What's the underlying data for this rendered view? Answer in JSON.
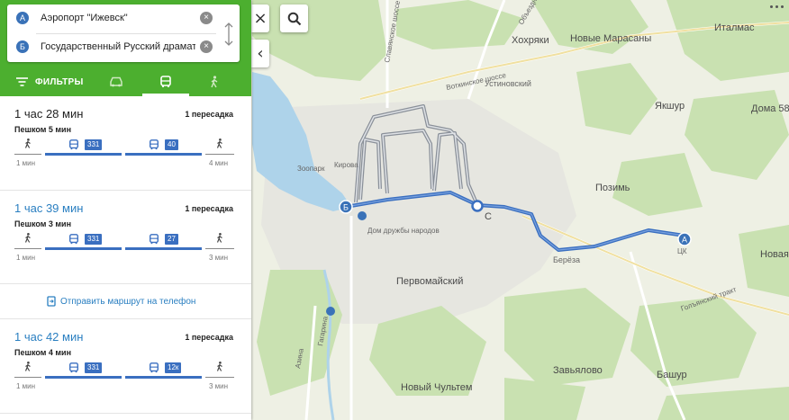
{
  "search": {
    "from_badge": "А",
    "from_value": "Аэропорт \"Ижевск\"",
    "to_badge": "Б",
    "to_value": "Государственный Русский драмат"
  },
  "filters": {
    "label": "ФИЛЬТРЫ",
    "modes": [
      {
        "name": "car",
        "icon": "car-icon",
        "active": false
      },
      {
        "name": "bus",
        "icon": "bus-icon",
        "active": true
      },
      {
        "name": "walk",
        "icon": "walk-icon",
        "active": false
      }
    ]
  },
  "routes": [
    {
      "duration": "1 час 28 мин",
      "transfers": "1 пересадка",
      "walk": "Пешком 5 мин",
      "start_walk": "1 мин",
      "bus1": "331",
      "bus2": "40",
      "end_walk": "4 мин"
    },
    {
      "duration": "1 час 39 мин",
      "transfers": "1 пересадка",
      "walk": "Пешком 3 мин",
      "start_walk": "1 мин",
      "bus1": "331",
      "bus2": "27",
      "end_walk": "3 мин"
    },
    {
      "duration": "1 час 42 мин",
      "transfers": "1 пересадка",
      "walk": "Пешком 4 мин",
      "start_walk": "1 мин",
      "bus1": "331",
      "bus2": "12к",
      "end_walk": "3 мин"
    }
  ],
  "send_to_phone": "Отправить маршрут на телефон",
  "map": {
    "labels": {
      "khokhryaki": "Хохряки",
      "novye_marasany": "Новые Марасаны",
      "italmas": "Италмас",
      "ustinovsky": "Устиновский",
      "yakshur": "Якшур",
      "doma58": "Дома 58",
      "votkinskoe": "Воткинское шоссе",
      "slavyanskoe": "Славянское шоссе",
      "obezdnaya": "Объездная",
      "zoopark": "Зоопарк",
      "kirova": "Кирова",
      "dom_druzhby": "Дом дружбы народов",
      "pozim": "Позимь",
      "bereza": "Берёза",
      "novaya": "Новая",
      "pervomaysky": "Первомайский",
      "gagarina": "Гагарина",
      "azina": "Азина",
      "golyanskiy": "Голъянский тракт",
      "zavyalovo": "Завьялово",
      "bashur": "Башур",
      "novy_chultem": "Новый Чультем",
      "lk": "ЦК",
      "pos_a": "А",
      "pos_b": "Б",
      "sarapul": "С"
    },
    "colors": {
      "route": "#3a6fc0",
      "alt_route": "#8a9099",
      "forest": "#c6dfae",
      "water": "#aed3ea"
    }
  },
  "controls": {
    "close": "×",
    "collapse": "‹"
  }
}
